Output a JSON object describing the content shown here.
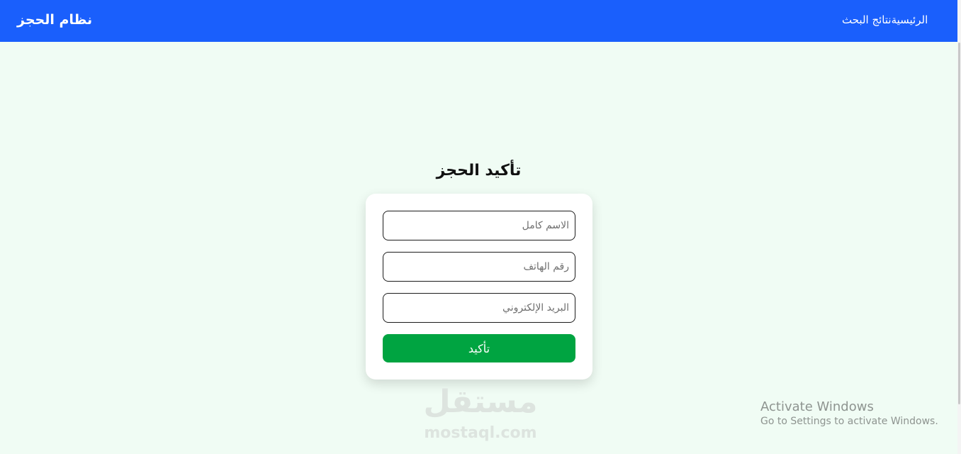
{
  "navbar": {
    "brand": "نظام الحجز",
    "links": [
      "الرئيسية",
      "نتائج البحث"
    ],
    "bg_color": "#1a5ffc"
  },
  "main": {
    "title": "تأكيد الحجز",
    "form": {
      "name_placeholder": "الاسم كامل",
      "phone_placeholder": "رقم الهاتف",
      "email_placeholder": "البريد الإلكتروني",
      "submit_label": "تأكيد",
      "submit_color": "#00a441"
    }
  },
  "watermark": {
    "logo_text": "مستقل",
    "url": "mostaql.com"
  },
  "activate_windows": {
    "title": "Activate Windows",
    "subtitle": "Go to Settings to activate Windows."
  },
  "page_bg_color": "#f0fcf4"
}
